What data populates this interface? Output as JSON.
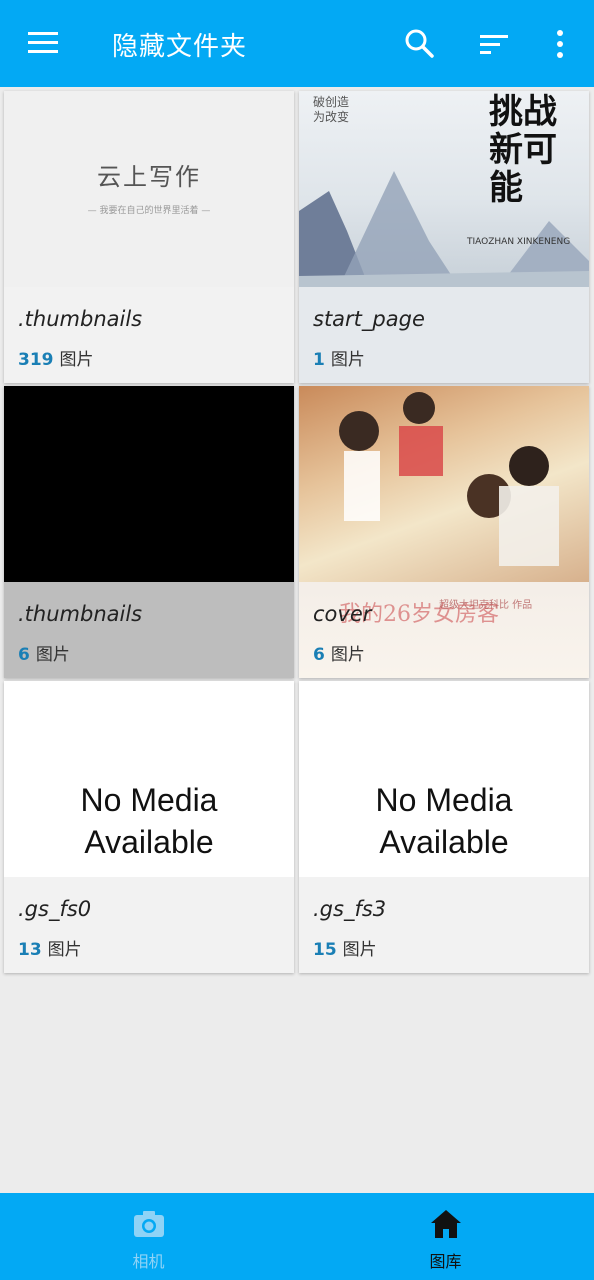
{
  "appbar": {
    "title": "隐藏文件夹",
    "icons": [
      "menu-icon",
      "search-icon",
      "sort-icon",
      "more-vert-icon"
    ],
    "color": "#03a9f4"
  },
  "folders": [
    {
      "name": ".thumbnails",
      "count": "319",
      "unit": "图片",
      "thumb_text": "云上写作",
      "thumb_subtext": "— 我要在自己的世界里活着 —"
    },
    {
      "name": "start_page",
      "count": "1",
      "unit": "图片",
      "thumb_text": "挑战新可能",
      "thumb_subtext": "TIAOZHAN XINKENENG",
      "thumb_side": "破创造 为改变"
    },
    {
      "name": ".thumbnails",
      "count": "6",
      "unit": "图片"
    },
    {
      "name": "cover",
      "count": "6",
      "unit": "图片",
      "thumb_text": "我的26岁女房客",
      "thumb_subtext": "超级大坦克科比 作品"
    },
    {
      "name": ".gs_fs0",
      "count": "13",
      "unit": "图片",
      "thumb_text": "No Media Available"
    },
    {
      "name": ".gs_fs3",
      "count": "15",
      "unit": "图片",
      "thumb_text": "No Media Available"
    }
  ],
  "bottom_nav": {
    "camera_label": "相机",
    "gallery_label": "图库",
    "selected": "gallery"
  },
  "colors": {
    "count_number": "#1a7fb5",
    "nav_bg": "#03a9f4",
    "page_bg": "#ececec"
  }
}
